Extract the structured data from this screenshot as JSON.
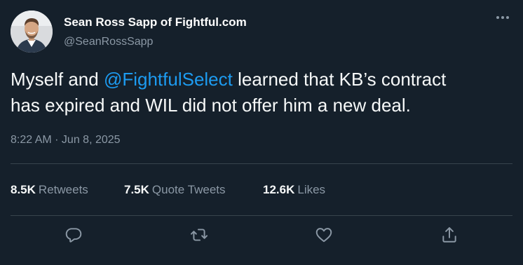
{
  "author": {
    "display_name": "Sean Ross Sapp of Fightful.com",
    "handle": "@SeanRossSapp"
  },
  "tweet": {
    "line1_before": "Myself and ",
    "mention": "@FightfulSelect",
    "line1_after": " learned that KB’s contract",
    "line2": "has expired and WIL did not offer him a new deal."
  },
  "meta": {
    "time": "8:22 AM",
    "separator": " · ",
    "date": "Jun 8, 2025"
  },
  "stats": {
    "retweets_count": "8.5K",
    "retweets_label": "Retweets",
    "quote_count": "7.5K",
    "quote_label": "Quote Tweets",
    "likes_count": "12.6K",
    "likes_label": "Likes"
  },
  "icons": {
    "more": "more-horizontal-icon",
    "reply": "reply-icon",
    "retweet": "retweet-icon",
    "like": "heart-icon",
    "share": "share-icon"
  },
  "colors": {
    "background": "#15202b",
    "text_primary": "#f7f9f9",
    "text_secondary": "#8b98a5",
    "link": "#1d9bf0",
    "divider": "#38444d"
  }
}
